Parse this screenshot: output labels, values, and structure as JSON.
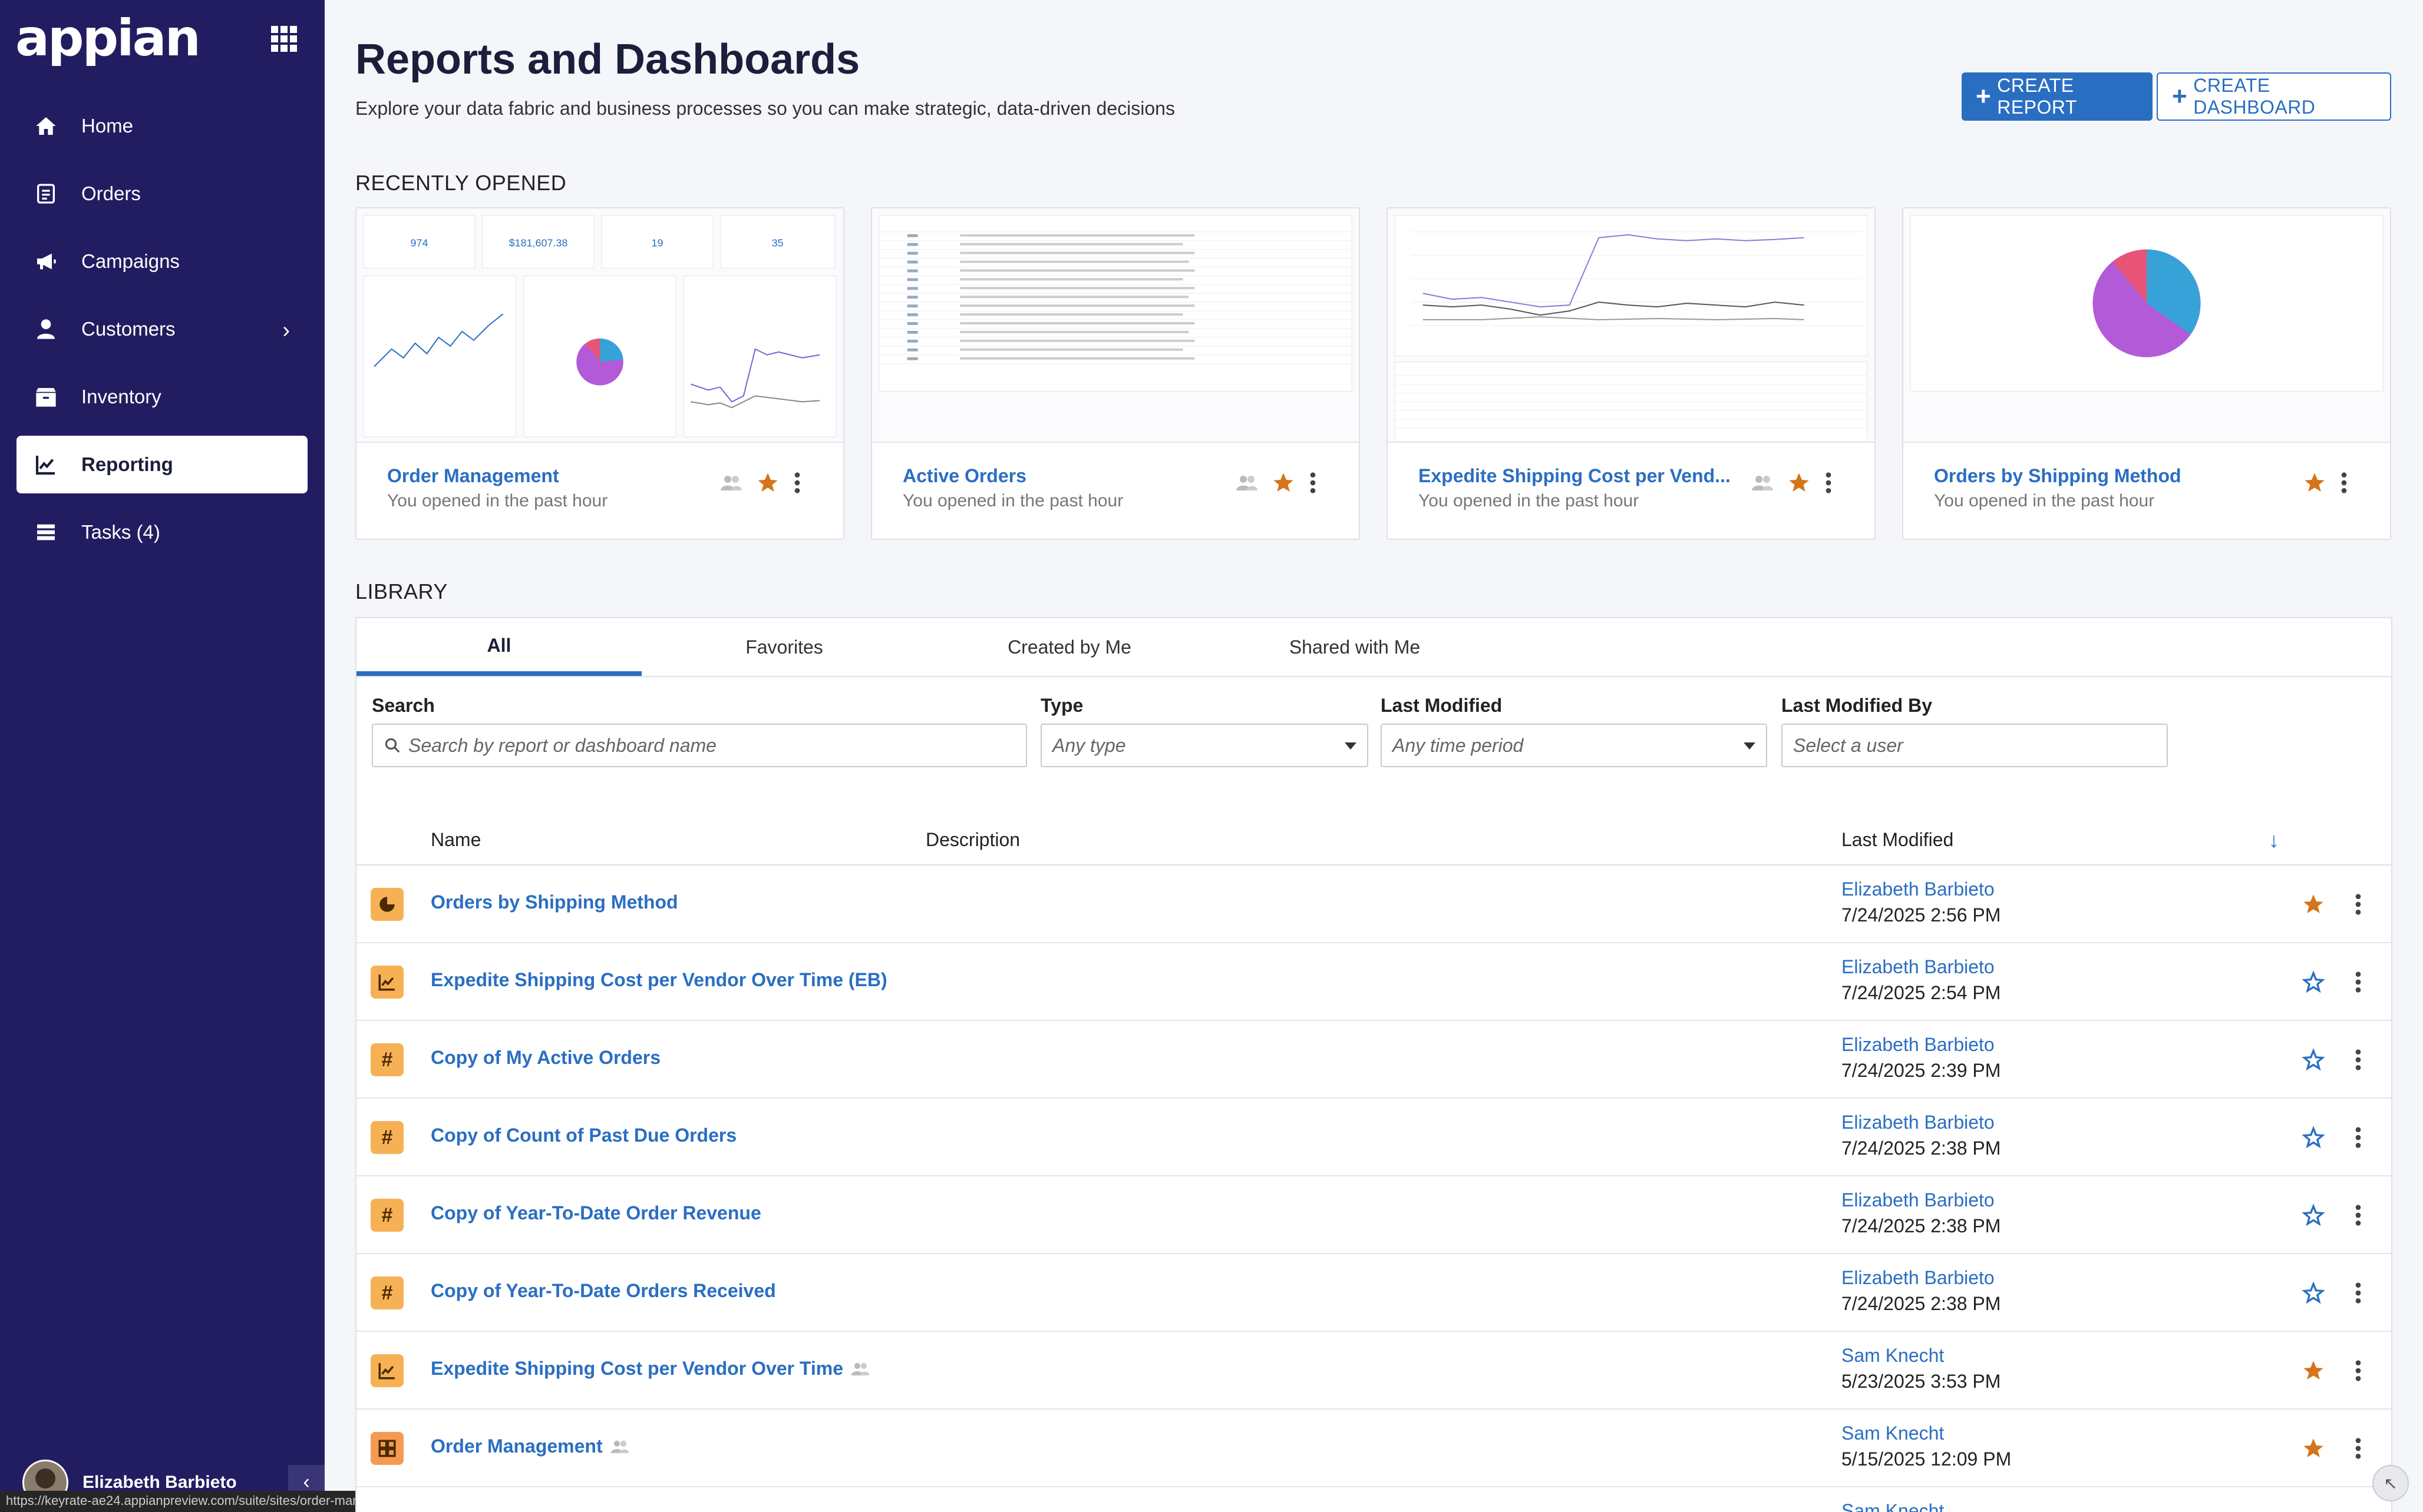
{
  "app": {
    "logo": "appian"
  },
  "sidebar": {
    "items": [
      {
        "label": "Home",
        "icon": "home-icon"
      },
      {
        "label": "Orders",
        "icon": "orders-icon"
      },
      {
        "label": "Campaigns",
        "icon": "megaphone-icon"
      },
      {
        "label": "Customers",
        "icon": "user-icon"
      },
      {
        "label": "Inventory",
        "icon": "inventory-icon"
      },
      {
        "label": "Reporting",
        "icon": "chart-line-icon"
      },
      {
        "label": "Tasks (4)",
        "icon": "tasks-icon"
      }
    ],
    "active": "Reporting",
    "user": {
      "name": "Elizabeth Barbieto"
    }
  },
  "header": {
    "title": "Reports and Dashboards",
    "subtitle": "Explore your data fabric and business processes so you can make strategic, data-driven decisions",
    "create_report": "CREATE REPORT",
    "create_dashboard": "CREATE DASHBOARD"
  },
  "recent": {
    "label": "RECENTLY OPENED",
    "cards": [
      {
        "title": "Order Management",
        "subtitle": "You opened in the past hour",
        "shared": true,
        "favorite": true
      },
      {
        "title": "Active Orders",
        "subtitle": "You opened in the past hour",
        "shared": true,
        "favorite": true
      },
      {
        "title": "Expedite Shipping Cost per Vend...",
        "subtitle": "You opened in the past hour",
        "shared": true,
        "favorite": true
      },
      {
        "title": "Orders by Shipping Method",
        "subtitle": "You opened in the past hour",
        "shared": false,
        "favorite": true
      }
    ],
    "thumb_kpis": {
      "values": [
        "974",
        "$181,607.38",
        "19",
        "35"
      ]
    }
  },
  "library": {
    "label": "LIBRARY",
    "tabs": [
      "All",
      "Favorites",
      "Created by Me",
      "Shared with Me"
    ],
    "active_tab": "All",
    "filters": {
      "search_label": "Search",
      "search_placeholder": "Search by report or dashboard name",
      "type_label": "Type",
      "type_value": "Any type",
      "modified_label": "Last Modified",
      "modified_value": "Any time period",
      "modified_by_label": "Last Modified By",
      "modified_by_placeholder": "Select a user"
    },
    "columns": {
      "name": "Name",
      "description": "Description",
      "last_modified": "Last Modified"
    },
    "rows": [
      {
        "name": "Orders by Shipping Method",
        "type": "pie",
        "user": "Elizabeth Barbieto",
        "date": "7/24/2025 2:56 PM",
        "favorite": true,
        "shared": false
      },
      {
        "name": "Expedite Shipping Cost per Vendor Over Time (EB)",
        "type": "line",
        "user": "Elizabeth Barbieto",
        "date": "7/24/2025 2:54 PM",
        "favorite": false,
        "shared": false
      },
      {
        "name": "Copy of My Active Orders",
        "type": "kpi",
        "user": "Elizabeth Barbieto",
        "date": "7/24/2025 2:39 PM",
        "favorite": false,
        "shared": false
      },
      {
        "name": "Copy of Count of Past Due Orders",
        "type": "kpi",
        "user": "Elizabeth Barbieto",
        "date": "7/24/2025 2:38 PM",
        "favorite": false,
        "shared": false
      },
      {
        "name": "Copy of Year-To-Date Order Revenue",
        "type": "kpi",
        "user": "Elizabeth Barbieto",
        "date": "7/24/2025 2:38 PM",
        "favorite": false,
        "shared": false
      },
      {
        "name": "Copy of Year-To-Date Orders Received",
        "type": "kpi",
        "user": "Elizabeth Barbieto",
        "date": "7/24/2025 2:38 PM",
        "favorite": false,
        "shared": false
      },
      {
        "name": "Expedite Shipping Cost per Vendor Over Time",
        "type": "line",
        "user": "Sam Knecht",
        "date": "5/23/2025 3:53 PM",
        "favorite": true,
        "shared": true
      },
      {
        "name": "Order Management",
        "type": "dashboard",
        "user": "Sam Knecht",
        "date": "5/15/2025 12:09 PM",
        "favorite": true,
        "shared": true
      },
      {
        "name": "",
        "type": "line",
        "user": "Sam Knecht",
        "date": "",
        "favorite": true,
        "shared": false
      }
    ]
  },
  "status_url": "https://keyrate-ae24.appianpreview.com/suite/sites/order-management/page/reporting",
  "colors": {
    "sidebar": "#221d60",
    "accent": "#2a6ec2",
    "star": "#d4741b",
    "type_icon": "#f7b155"
  }
}
